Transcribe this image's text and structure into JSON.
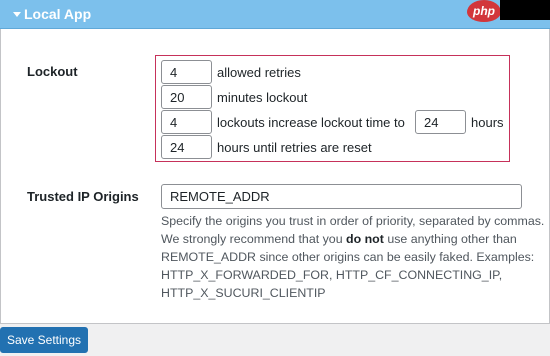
{
  "header": {
    "title": "Local App",
    "logo_text": "php"
  },
  "lockout": {
    "label": "Lockout",
    "allowed_retries": {
      "value": "4",
      "text": "allowed retries"
    },
    "minutes_lockout": {
      "value": "20",
      "text": "minutes lockout"
    },
    "increase": {
      "value": "4",
      "text": "lockouts increase lockout time to",
      "value2": "24",
      "text2": "hours"
    },
    "reset": {
      "value": "24",
      "text": "hours until retries are reset"
    }
  },
  "trusted": {
    "label": "Trusted IP Origins",
    "value": "REMOTE_ADDR",
    "description_part1": "Specify the origins you trust in order of priority, separated by commas. We strongly recommend that you ",
    "description_bold": "do not",
    "description_part2": " use anything other than REMOTE_ADDR since other origins can be easily faked. Examples: HTTP_X_FORWARDED_FOR, HTTP_CF_CONNECTING_IP, HTTP_X_SUCURI_CLIENTIP"
  },
  "footer": {
    "save_label": "Save Settings"
  },
  "colors": {
    "header_bg": "#7cc0ec",
    "highlight_border": "#c6315a",
    "button_bg": "#2271b1"
  }
}
